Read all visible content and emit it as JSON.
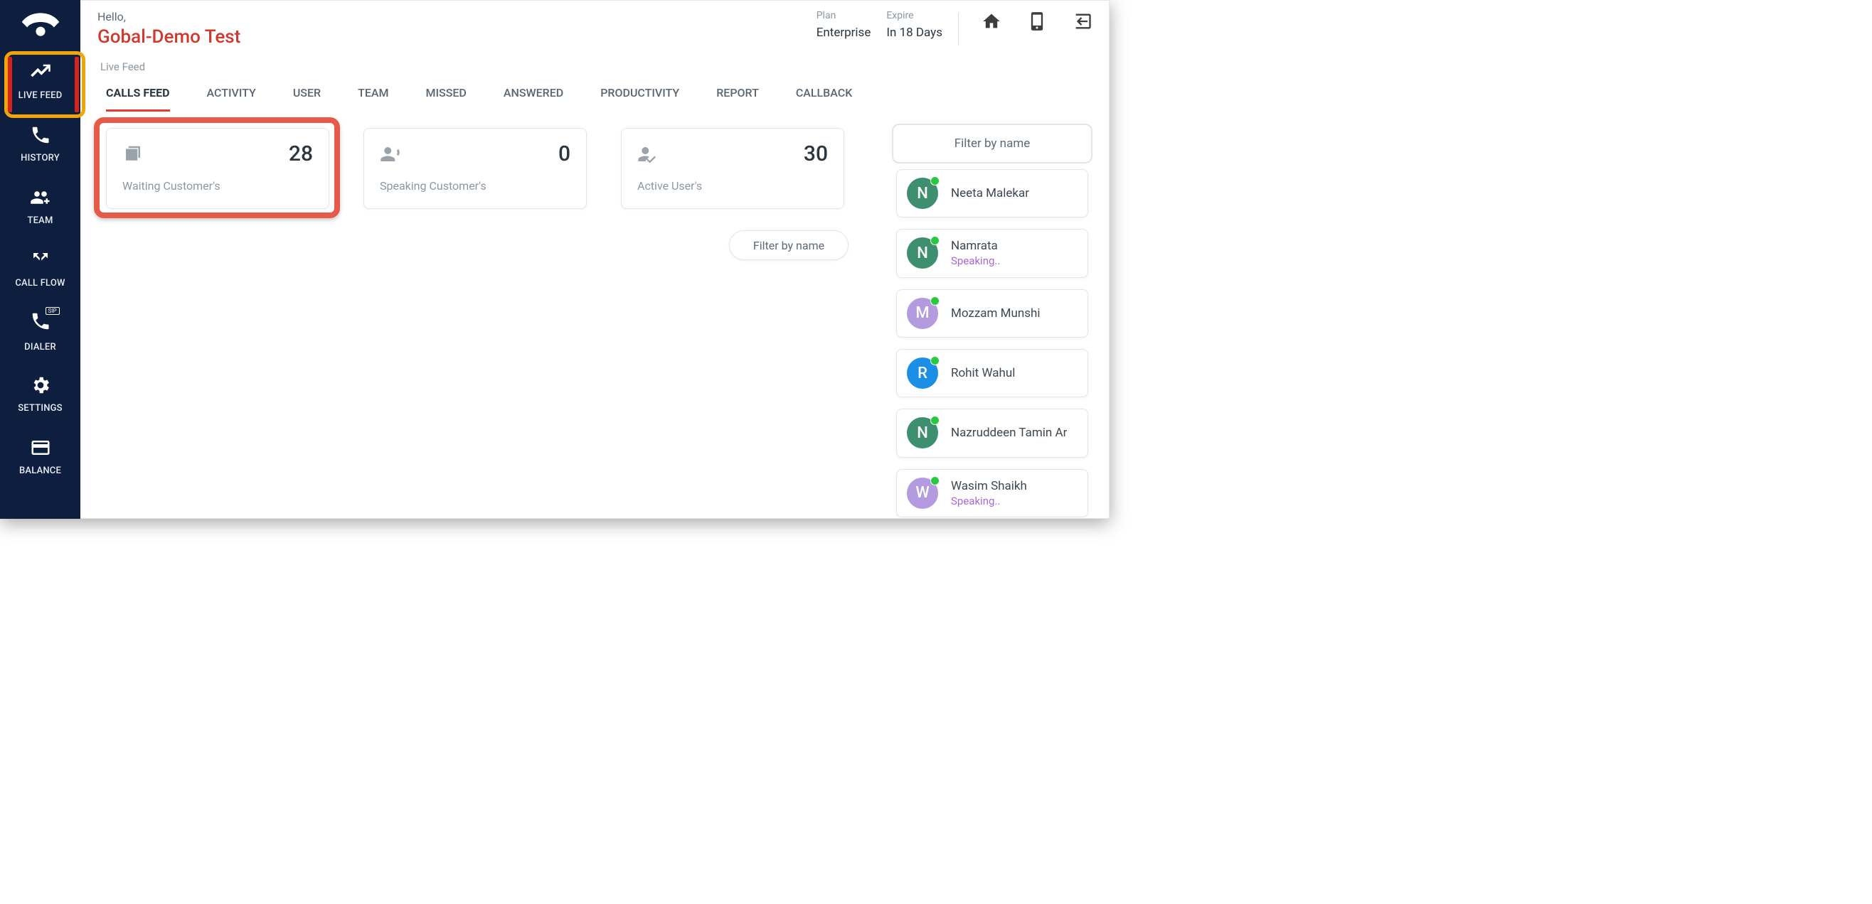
{
  "header": {
    "hello": "Hello,",
    "org": "Gobal-Demo Test",
    "plan_label": "Plan",
    "plan_value": "Enterprise",
    "expire_label": "Expire",
    "expire_value": "In 18 Days"
  },
  "breadcrumb": "Live Feed",
  "sidebar": {
    "items": [
      {
        "label": "LIVE FEED"
      },
      {
        "label": "HISTORY"
      },
      {
        "label": "TEAM"
      },
      {
        "label": "CALL FLOW"
      },
      {
        "label": "DIALER"
      },
      {
        "label": "SETTINGS"
      },
      {
        "label": "BALANCE"
      }
    ]
  },
  "tabs": [
    {
      "label": "CALLS FEED"
    },
    {
      "label": "ACTIVITY"
    },
    {
      "label": "USER"
    },
    {
      "label": "TEAM"
    },
    {
      "label": "MISSED"
    },
    {
      "label": "ANSWERED"
    },
    {
      "label": "PRODUCTIVITY"
    },
    {
      "label": "REPORT"
    },
    {
      "label": "CALLBACK"
    }
  ],
  "cards": {
    "waiting": {
      "value": "28",
      "label": "Waiting Customer's"
    },
    "speaking": {
      "value": "0",
      "label": "Speaking Customer's"
    },
    "active": {
      "value": "30",
      "label": "Active User's"
    }
  },
  "filter_chip": "Filter by name",
  "right_panel": {
    "filter_label": "Filter by name",
    "users": [
      {
        "initial": "N",
        "name": "Neeta Malekar",
        "status": "",
        "color": "#3e8f70"
      },
      {
        "initial": "N",
        "name": "Namrata",
        "status": "Speaking..",
        "color": "#3e8f70"
      },
      {
        "initial": "M",
        "name": "Mozzam Munshi",
        "status": "",
        "color": "#b49be0"
      },
      {
        "initial": "R",
        "name": "Rohit Wahul",
        "status": "",
        "color": "#1b8fe6"
      },
      {
        "initial": "N",
        "name": "Nazruddeen Tamin Ar",
        "status": "",
        "color": "#3e8f70"
      },
      {
        "initial": "W",
        "name": "Wasim Shaikh",
        "status": "Speaking..",
        "color": "#b49be0"
      }
    ]
  },
  "sip_label": "SIP"
}
